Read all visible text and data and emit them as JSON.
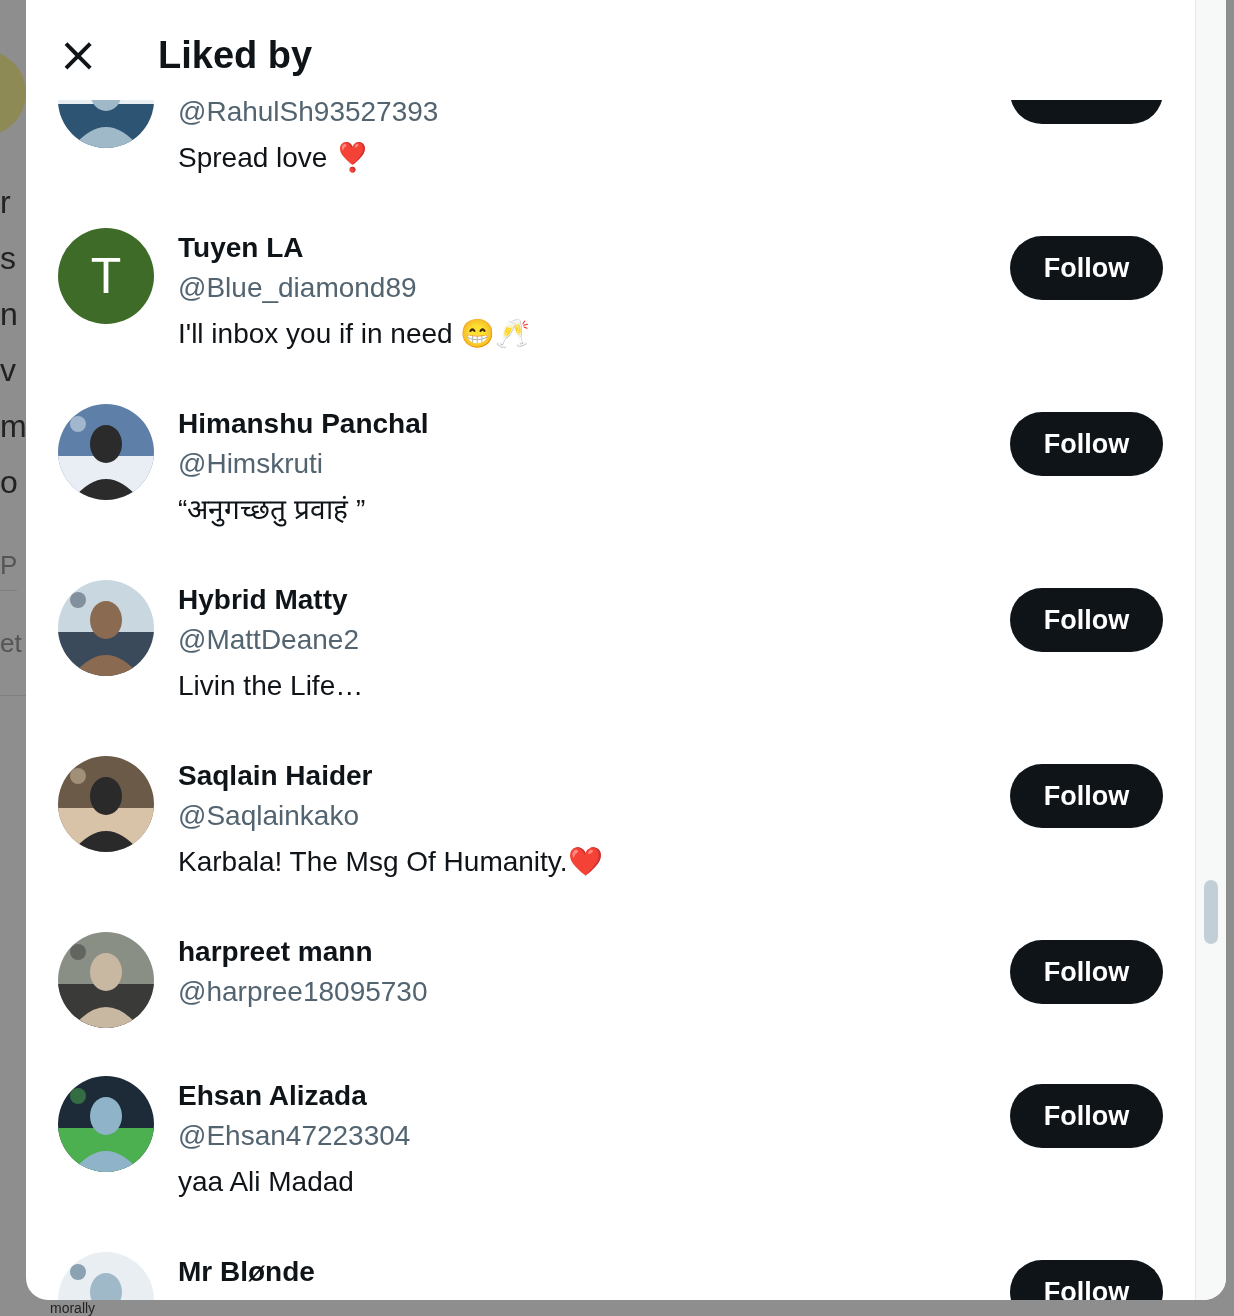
{
  "background": {
    "left_fragments": [
      "r",
      "s",
      "n",
      "v",
      "m",
      "o",
      "P",
      "et"
    ],
    "bottom_text": "morally"
  },
  "dialog": {
    "close": "×",
    "title": "Liked by"
  },
  "users": [
    {
      "handle": "@RahulSh93527393",
      "bio": "Spread love ❣️"
    },
    {
      "name": "Tuyen LA",
      "handle": "@Blue_diamond89",
      "bio": "I'll inbox you if in need 😁🥂",
      "avatar": {
        "kind": "initial",
        "initial": "T",
        "color": "#3e6b27"
      },
      "follow": "Follow"
    },
    {
      "name": "Himanshu Panchal",
      "handle": "@Himskruti",
      "bio": "“अनुगच्छतु प्रवाहं ”",
      "follow": "Follow"
    },
    {
      "name": "Hybrid Matty",
      "handle": "@MattDeane2",
      "bio": "Livin the Life…",
      "follow": "Follow"
    },
    {
      "name": "Saqlain Haider",
      "handle": "@Saqlainkako",
      "bio": "Karbala! The Msg Of Humanity.❤️",
      "follow": "Follow"
    },
    {
      "name": "harpreet mann",
      "handle": "@harpree18095730",
      "follow": "Follow"
    },
    {
      "name": "Ehsan Alizada",
      "handle": "@Ehsan47223304",
      "bio": "yaa Ali Madad",
      "follow": "Follow"
    },
    {
      "name": "Mr Blønde",
      "follow": "Follow"
    }
  ]
}
